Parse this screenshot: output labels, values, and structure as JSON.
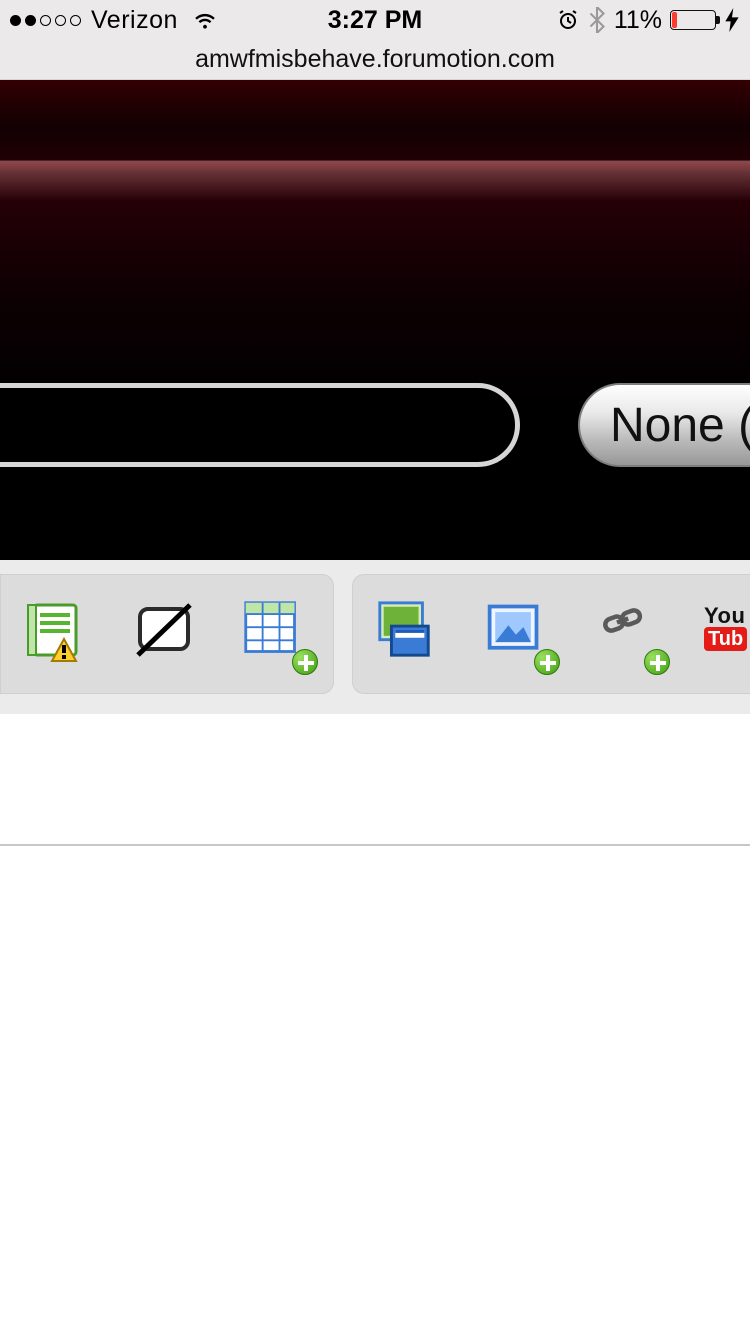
{
  "status": {
    "carrier": "Verizon",
    "time": "3:27 PM",
    "battery_pct": "11%"
  },
  "browser": {
    "address": "amwfmisbehave.forumotion.com"
  },
  "form": {
    "dropdown_label": "None ("
  },
  "toolbar": {
    "group1": {
      "notes_icon": "notes-warning-icon",
      "tablet_icon": "device-disable-icon",
      "table_icon": "insert-table-icon"
    },
    "group2": {
      "imghost_icon": "image-host-icon",
      "imgadd_icon": "insert-image-icon",
      "link_icon": "insert-link-icon",
      "youtube_icon": "youtube-icon",
      "yt_l1": "You",
      "yt_l2": "Tub"
    }
  }
}
